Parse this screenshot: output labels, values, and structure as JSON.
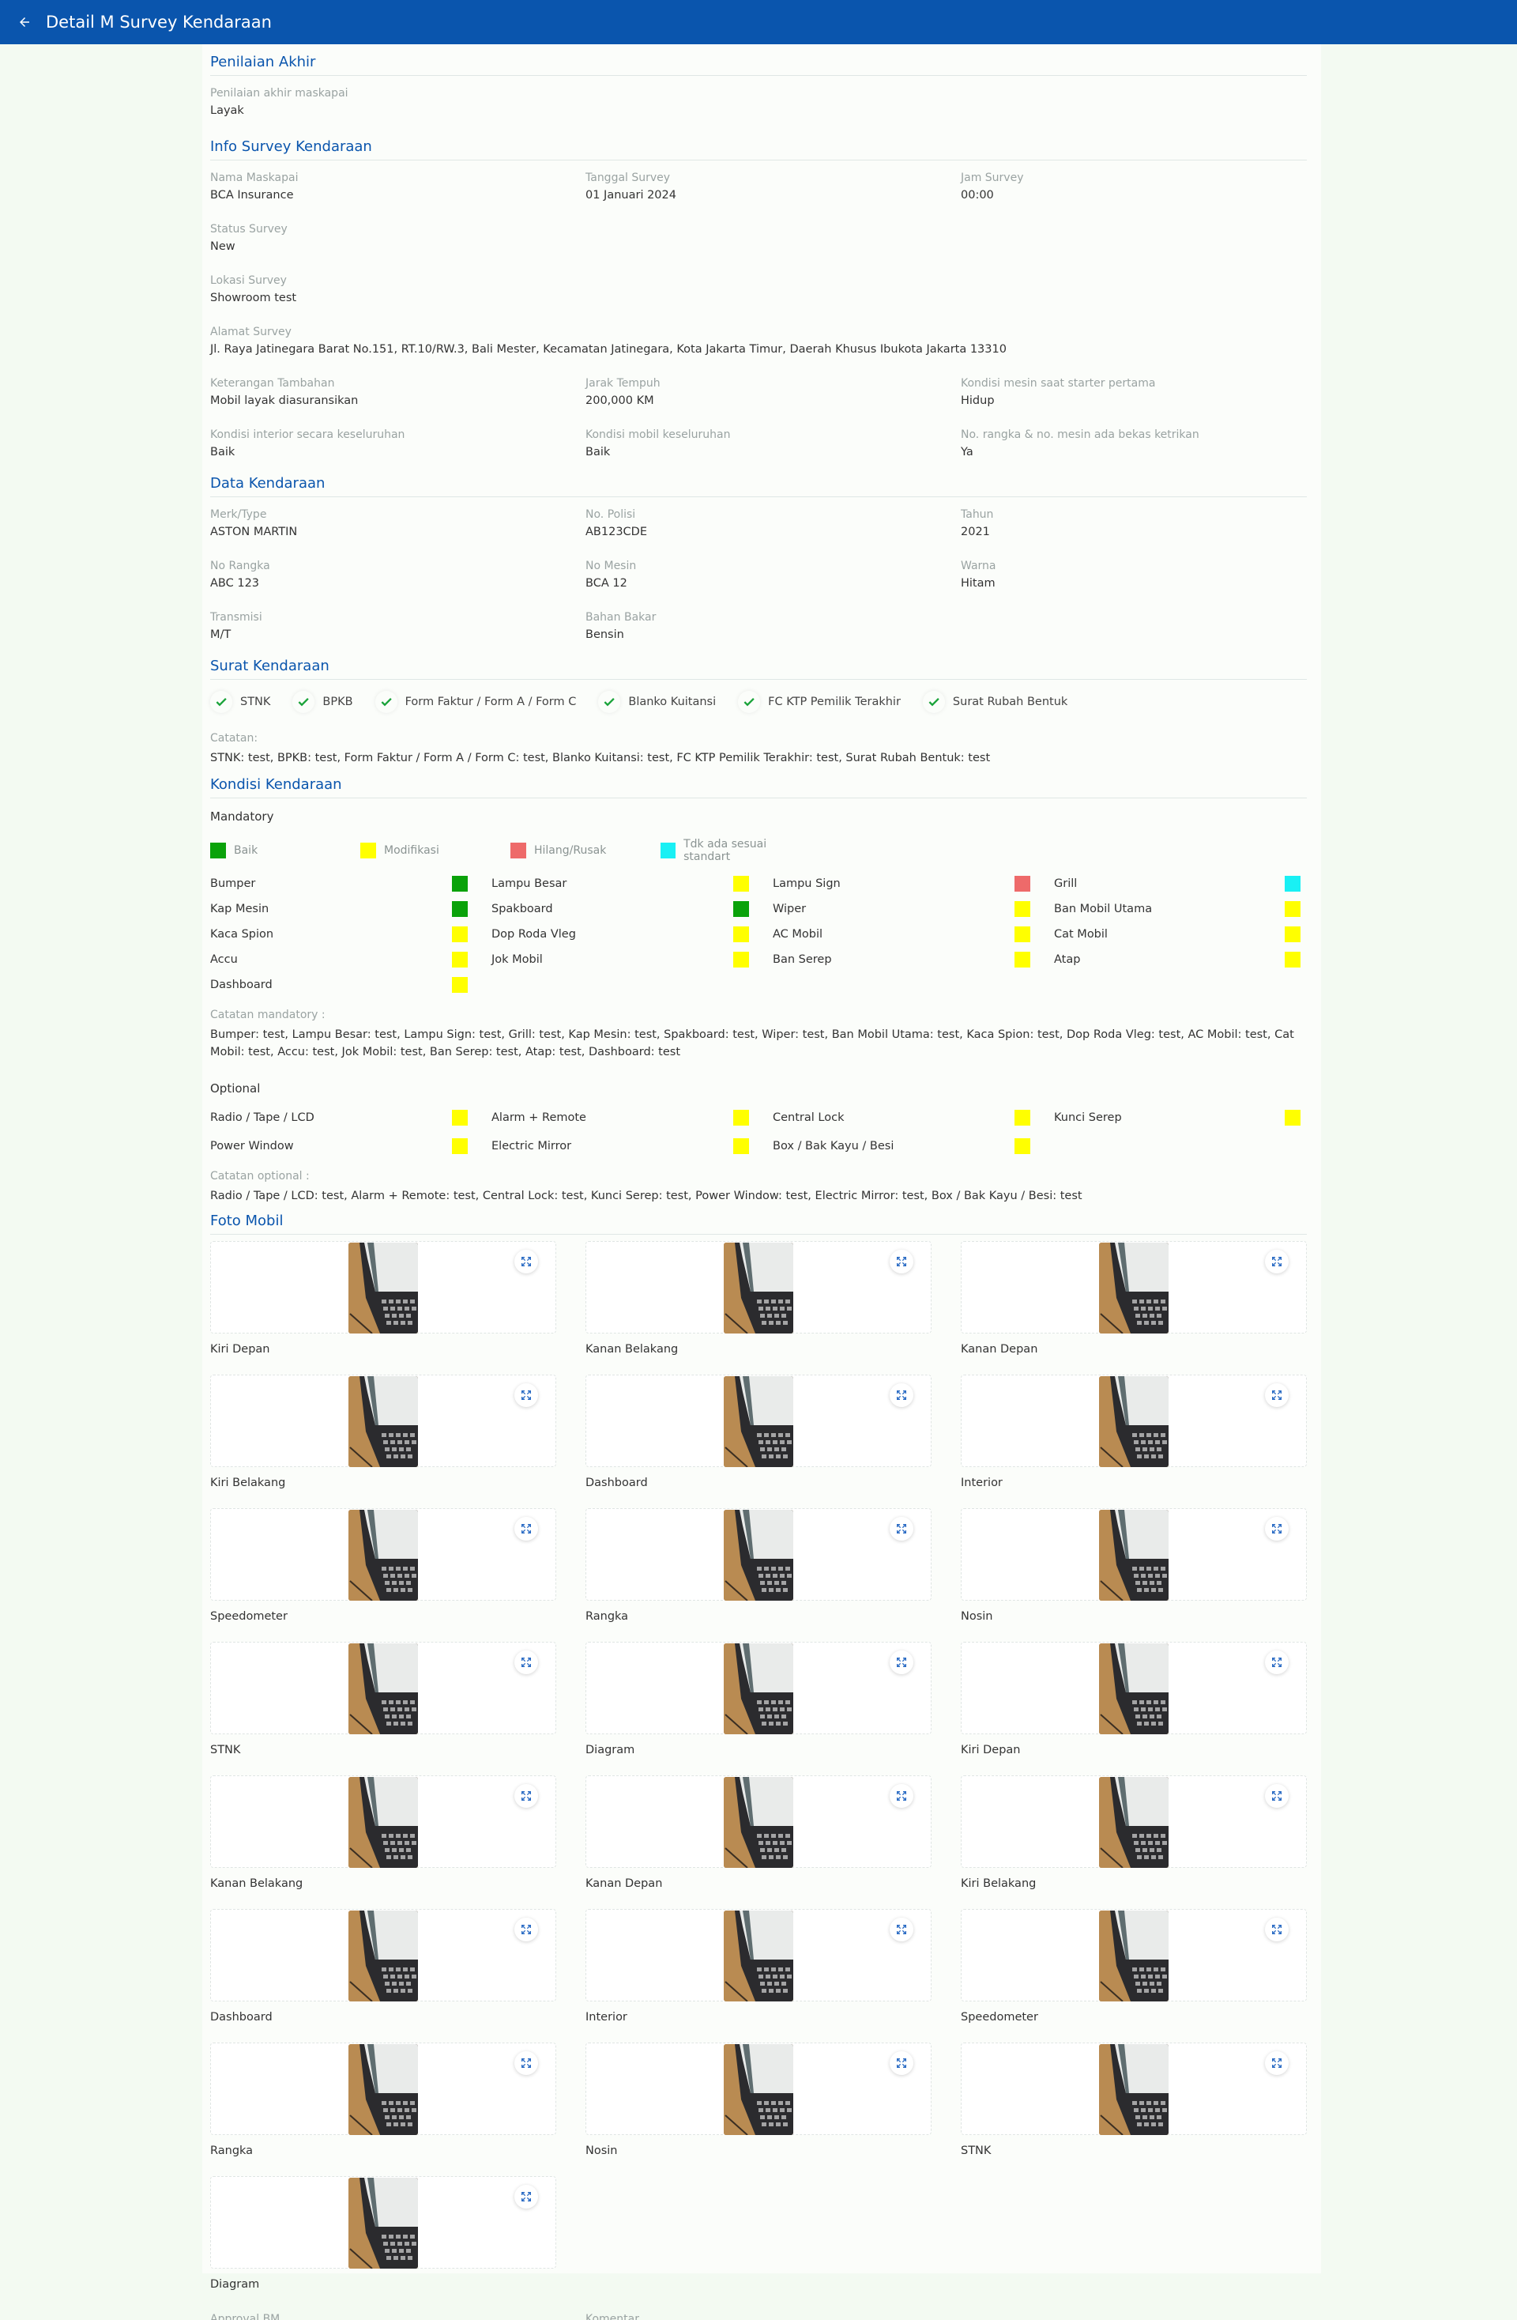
{
  "header": {
    "title": "Detail M Survey Kendaraan",
    "back_icon": "arrow-left-icon"
  },
  "penilaian": {
    "title": "Penilaian Akhir",
    "label": "Penilaian akhir maskapai",
    "value": "Layak"
  },
  "info": {
    "title": "Info Survey Kendaraan",
    "fields": [
      {
        "label": "Nama Maskapai",
        "value": "BCA Insurance"
      },
      {
        "label": "Tanggal Survey",
        "value": "01 Januari 2024"
      },
      {
        "label": "Jam Survey",
        "value": "00:00"
      },
      {
        "label": "Status Survey",
        "value": "New"
      },
      {
        "label": "Lokasi Survey",
        "value": "Showroom test"
      },
      {
        "label": "Alamat Survey",
        "value": "Jl. Raya Jatinegara Barat No.151, RT.10/RW.3, Bali Mester, Kecamatan Jatinegara, Kota Jakarta Timur, Daerah Khusus Ibukota Jakarta 13310"
      },
      {
        "label": "Keterangan Tambahan",
        "value": "Mobil layak diasuransikan"
      },
      {
        "label": "Jarak Tempuh",
        "value": "200,000 KM"
      },
      {
        "label": "Kondisi mesin saat starter pertama",
        "value": "Hidup"
      },
      {
        "label": "Kondisi interior secara keseluruhan",
        "value": "Baik"
      },
      {
        "label": "Kondisi mobil keseluruhan",
        "value": "Baik"
      },
      {
        "label": "No. rangka & no. mesin ada bekas ketrikan",
        "value": "Ya"
      }
    ]
  },
  "kendaraan": {
    "title": "Data Kendaraan",
    "fields": [
      {
        "label": "Merk/Type",
        "value": "ASTON MARTIN"
      },
      {
        "label": "No. Polisi",
        "value": "AB123CDE"
      },
      {
        "label": "Tahun",
        "value": "2021"
      },
      {
        "label": "No Rangka",
        "value": "ABC 123"
      },
      {
        "label": "No Mesin",
        "value": "BCA 12"
      },
      {
        "label": "Warna",
        "value": "Hitam"
      },
      {
        "label": "Transmisi",
        "value": "M/T"
      },
      {
        "label": "Bahan Bakar",
        "value": "Bensin"
      }
    ]
  },
  "surat": {
    "title": "Surat Kendaraan",
    "docs": [
      "STNK",
      "BPKB",
      "Form Faktur / Form A / Form C",
      "Blanko Kuitansi",
      "FC KTP Pemilik Terakhir",
      "Surat Rubah Bentuk"
    ],
    "check_color": "#1aa33a",
    "note_label": "Catatan:",
    "note_value": "STNK: test, BPKB: test, Form Faktur / Form A / Form C: test, Blanko Kuitansi: test, FC KTP Pemilik Terakhir: test, Surat Rubah Bentuk: test"
  },
  "kondisi": {
    "title": "Kondisi Kendaraan",
    "mandatory_label": "Mandatory",
    "legend": [
      {
        "label": "Baik",
        "color": "#0aa20a"
      },
      {
        "label": "Modifikasi",
        "color": "#ffff00"
      },
      {
        "label": "Hilang/Rusak",
        "color": "#ee6a6a"
      },
      {
        "label": "Tdk ada sesuai standart",
        "color": "#19f0f4"
      }
    ],
    "mandatory": [
      {
        "name": "Bumper",
        "color": "#0aa20a"
      },
      {
        "name": "Lampu Besar",
        "color": "#ffff00"
      },
      {
        "name": "Lampu Sign",
        "color": "#ee6a6a"
      },
      {
        "name": "Grill",
        "color": "#19f0f4"
      },
      {
        "name": "Kap Mesin",
        "color": "#0aa20a"
      },
      {
        "name": "Spakboard",
        "color": "#0aa20a"
      },
      {
        "name": "Wiper",
        "color": "#ffff00"
      },
      {
        "name": "Ban Mobil Utama",
        "color": "#ffff00"
      },
      {
        "name": "Kaca Spion",
        "color": "#ffff00"
      },
      {
        "name": "Dop Roda Vleg",
        "color": "#ffff00"
      },
      {
        "name": "AC Mobil",
        "color": "#ffff00"
      },
      {
        "name": "Cat Mobil",
        "color": "#ffff00"
      },
      {
        "name": "Accu",
        "color": "#ffff00"
      },
      {
        "name": "Jok Mobil",
        "color": "#ffff00"
      },
      {
        "name": "Ban Serep",
        "color": "#ffff00"
      },
      {
        "name": "Atap",
        "color": "#ffff00"
      },
      {
        "name": "Dashboard",
        "color": "#ffff00"
      }
    ],
    "mandatory_note_label": "Catatan mandatory :",
    "mandatory_note_value": "Bumper: test, Lampu Besar: test, Lampu Sign: test, Grill: test, Kap Mesin: test, Spakboard: test, Wiper: test, Ban Mobil Utama: test, Kaca Spion: test, Dop Roda Vleg: test, AC Mobil: test, Cat Mobil: test, Accu: test, Jok Mobil: test, Ban Serep: test, Atap: test, Dashboard: test",
    "optional_label": "Optional",
    "optional": [
      {
        "name": "Radio / Tape / LCD",
        "color": "#ffff00"
      },
      {
        "name": "Alarm + Remote",
        "color": "#ffff00"
      },
      {
        "name": "Central Lock",
        "color": "#ffff00"
      },
      {
        "name": "Kunci Serep",
        "color": "#ffff00"
      },
      {
        "name": "Power Window",
        "color": "#ffff00"
      },
      {
        "name": "Electric Mirror",
        "color": "#ffff00"
      },
      {
        "name": "Box / Bak Kayu / Besi",
        "color": "#ffff00"
      }
    ],
    "optional_note_label": "Catatan optional :",
    "optional_note_value": "Radio / Tape / LCD: test, Alarm + Remote: test, Central Lock: test, Kunci Serep: test, Power Window: test, Electric Mirror: test, Box / Bak Kayu / Besi: test"
  },
  "foto": {
    "title": "Foto Mobil",
    "expand_icon": "expand-icon",
    "items": [
      "Kiri Depan",
      "Kanan Belakang",
      "Kanan Depan",
      "Kiri Belakang",
      "Dashboard",
      "Interior",
      "Speedometer",
      "Rangka",
      "Nosin",
      "STNK",
      "Diagram",
      "Kiri Depan",
      "Kanan Belakang",
      "Kanan Depan",
      "Kiri Belakang",
      "Dashboard",
      "Interior",
      "Speedometer",
      "Rangka",
      "Nosin",
      "STNK",
      "Diagram"
    ]
  },
  "approval": {
    "bm_label": "Approval BM",
    "bm_value": "-",
    "komentar_label": "Komentar",
    "komentar_value": "-"
  }
}
